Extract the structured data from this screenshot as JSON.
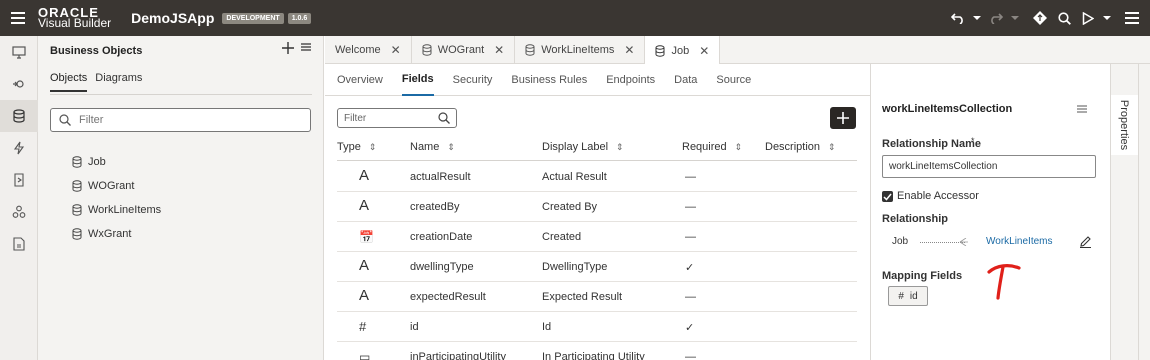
{
  "header": {
    "logo_line1": "ORACLE",
    "logo_line2": "Visual Builder",
    "app_name": "DemoJSApp",
    "env_badge": "DEVELOPMENT",
    "version_badge": "1.0.6"
  },
  "left_panel": {
    "title": "Business Objects",
    "tabs": [
      {
        "label": "Objects",
        "active": true
      },
      {
        "label": "Diagrams",
        "active": false
      }
    ],
    "filter_placeholder": "Filter",
    "objects": [
      "Job",
      "WOGrant",
      "WorkLineItems",
      "WxGrant"
    ]
  },
  "editor_tabs": [
    {
      "label": "Welcome",
      "icon": "none",
      "active": false
    },
    {
      "label": "WOGrant",
      "icon": "database-icon",
      "active": false
    },
    {
      "label": "WorkLineItems",
      "icon": "database-icon",
      "active": false
    },
    {
      "label": "Job",
      "icon": "database-icon",
      "active": true
    }
  ],
  "sub_tabs": [
    "Overview",
    "Fields",
    "Security",
    "Business Rules",
    "Endpoints",
    "Data",
    "Source"
  ],
  "active_sub_tab": "Fields",
  "table": {
    "filter_placeholder": "Filter",
    "columns": [
      "Type",
      "Name",
      "Display Label",
      "Required",
      "Description"
    ],
    "rows": [
      {
        "type_glyph": "A",
        "name": "actualResult",
        "label": "Actual Result",
        "required": "—"
      },
      {
        "type_glyph": "A",
        "name": "createdBy",
        "label": "Created By",
        "required": "—"
      },
      {
        "type_glyph": "📅",
        "name": "creationDate",
        "label": "Created",
        "required": "—"
      },
      {
        "type_glyph": "A",
        "name": "dwellingType",
        "label": "DwellingType",
        "required": "✓"
      },
      {
        "type_glyph": "A",
        "name": "expectedResult",
        "label": "Expected Result",
        "required": "—"
      },
      {
        "type_glyph": "#",
        "name": "id",
        "label": "Id",
        "required": "✓"
      },
      {
        "type_glyph": "▭",
        "name": "inParticipatingUtility",
        "label": "In Participating Utility",
        "required": "—"
      }
    ]
  },
  "properties": {
    "title": "workLineItemsCollection",
    "relationship_name_label": "Relationship Name",
    "required_marker": "*",
    "relationship_name_value": "workLineItemsCollection",
    "enable_accessor_label": "Enable Accessor",
    "enable_accessor_checked": true,
    "relationship_label": "Relationship",
    "rel_source": "Job",
    "rel_target": "WorkLineItems",
    "mapping_fields_label": "Mapping Fields",
    "mapping_field_icon": "#",
    "mapping_field": "id",
    "side_tab": "Properties"
  },
  "annotation_color": "#e0201a"
}
